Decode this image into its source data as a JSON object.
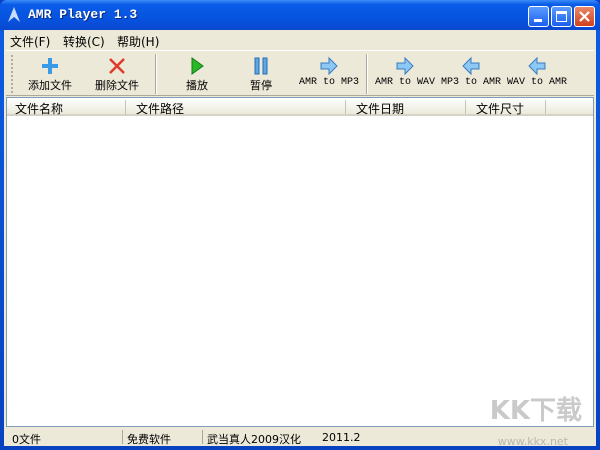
{
  "window": {
    "title": "AMR Player 1.3"
  },
  "menu": [
    {
      "label": "文件(F)"
    },
    {
      "label": "转换(C)"
    },
    {
      "label": "帮助(H)"
    }
  ],
  "toolbar": [
    {
      "label": "添加文件",
      "icon": "plus-icon"
    },
    {
      "label": "删除文件",
      "icon": "x-icon"
    },
    {
      "label": "播放",
      "icon": "play-icon"
    },
    {
      "label": "暂停",
      "icon": "pause-icon"
    },
    {
      "label": "AMR to MP3",
      "icon": "arrow-right-icon"
    },
    {
      "label": "AMR to WAV",
      "icon": "arrow-right-icon"
    },
    {
      "label": "MP3 to AMR",
      "icon": "arrow-left-icon"
    },
    {
      "label": "WAV to AMR",
      "icon": "arrow-left-icon"
    }
  ],
  "columns": [
    "文件名称",
    "文件路径",
    "文件日期",
    "文件尺寸"
  ],
  "rows": [],
  "status": [
    "0文件",
    "免费软件",
    "武当真人2009汉化",
    "2011.2"
  ],
  "watermark": {
    "logo": "KK下载",
    "url": "www.kkx.net"
  }
}
